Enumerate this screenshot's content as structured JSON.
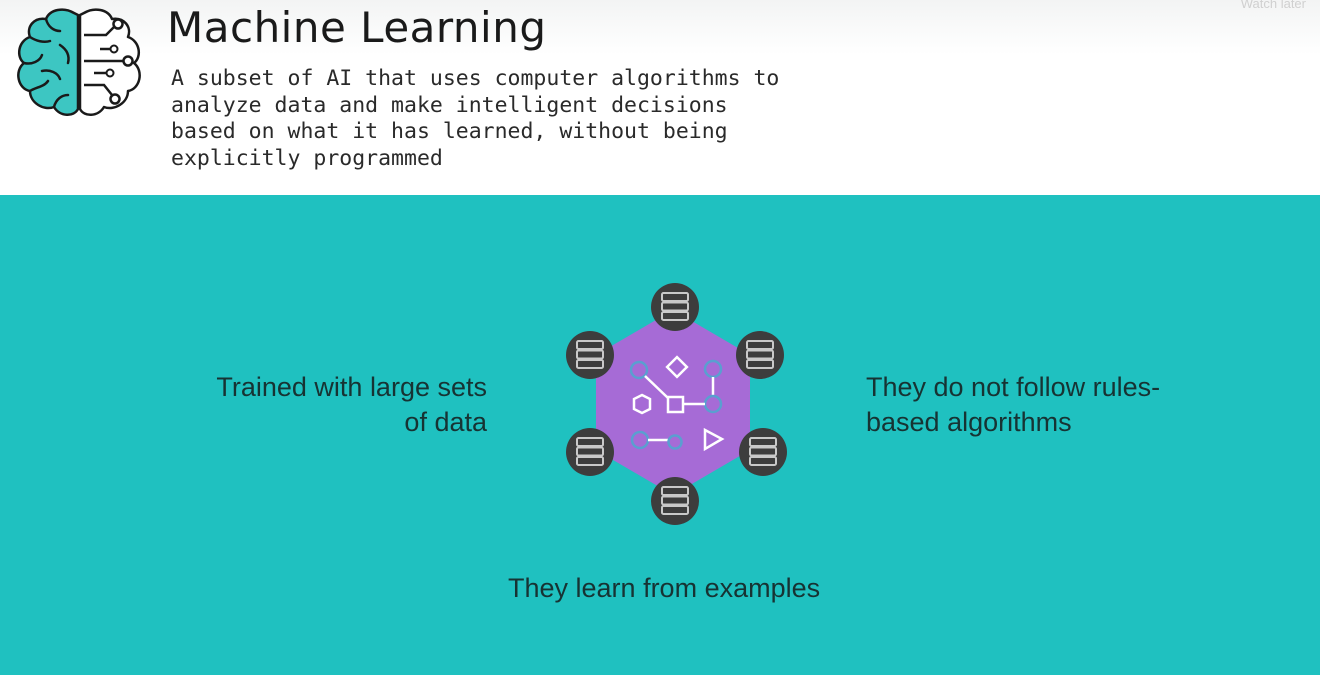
{
  "header": {
    "title": "Machine Learning",
    "definition": "A subset of AI that uses computer algorithms to analyze data and make intelligent decisions based on what it has learned, without being explicitly programmed",
    "brain_icon": "brain-circuit-icon"
  },
  "player": {
    "watch_later_label": "Watch later"
  },
  "diagram": {
    "center_icon": "algorithm-hexagon-icon",
    "node_icon": "database-icon",
    "node_count": 6
  },
  "captions": {
    "left": "Trained with large sets of data",
    "right": "They do not follow rules-based algorithms",
    "bottom": "They learn from examples"
  },
  "colors": {
    "teal": "#1fc1c0",
    "brain_teal": "#3dc6c2",
    "hexagon_purple": "#a66bd6",
    "node_dark": "#3d3d3d"
  }
}
